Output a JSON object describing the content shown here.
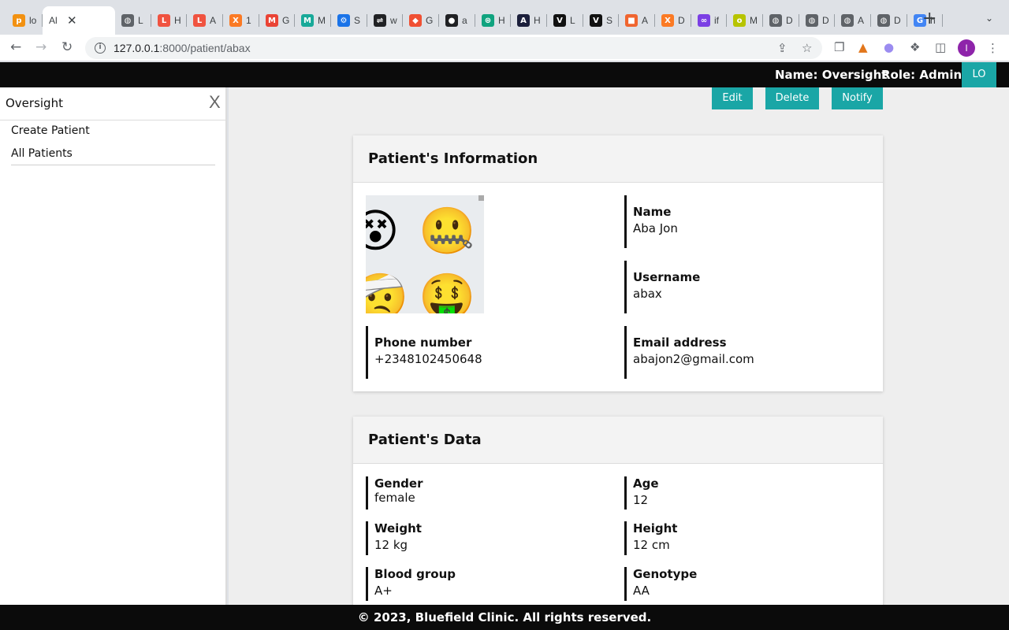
{
  "browser": {
    "tabs": [
      {
        "label": "lo",
        "icon": "pma",
        "color": "#f29111"
      },
      {
        "label": "Al",
        "icon": "",
        "color": "#ffffff",
        "active": true
      },
      {
        "label": "L",
        "icon": "globe",
        "color": "#5f6368"
      },
      {
        "label": "H",
        "icon": "laravel",
        "color": "#f05340"
      },
      {
        "label": "A",
        "icon": "laravel",
        "color": "#f05340"
      },
      {
        "label": "1",
        "icon": "xampp",
        "color": "#fb7a24"
      },
      {
        "label": "G",
        "icon": "gmail",
        "color": "#ea4335"
      },
      {
        "label": "M",
        "icon": "m",
        "color": "#18a999"
      },
      {
        "label": "S",
        "icon": "gear",
        "color": "#1a73e8"
      },
      {
        "label": "w",
        "icon": "net",
        "color": "#202124"
      },
      {
        "label": "G",
        "icon": "git",
        "color": "#f05033"
      },
      {
        "label": "a",
        "icon": "github",
        "color": "#202124"
      },
      {
        "label": "H",
        "icon": "gpt",
        "color": "#10a37f"
      },
      {
        "label": "H",
        "icon": "a",
        "color": "#1b1f3b"
      },
      {
        "label": "L",
        "icon": "v",
        "color": "#111111"
      },
      {
        "label": "S",
        "icon": "v",
        "color": "#111111"
      },
      {
        "label": "A",
        "icon": "box",
        "color": "#f0652f"
      },
      {
        "label": "D",
        "icon": "xampp",
        "color": "#fb7a24"
      },
      {
        "label": "if",
        "icon": "inf",
        "color": "#7b3fe4"
      },
      {
        "label": "M",
        "icon": "o",
        "color": "#b7c400"
      },
      {
        "label": "D",
        "icon": "globe",
        "color": "#5f6368"
      },
      {
        "label": "D",
        "icon": "globe",
        "color": "#5f6368"
      },
      {
        "label": "A",
        "icon": "globe",
        "color": "#5f6368"
      },
      {
        "label": "D",
        "icon": "globe",
        "color": "#5f6368"
      },
      {
        "label": "h",
        "icon": "google",
        "color": "#4285f4"
      }
    ],
    "url_host": "127.0.0.1",
    "url_path": ":8000/patient/abax",
    "profile_initial": "I"
  },
  "header": {
    "user_name": "Name: Oversight",
    "user_role": "Role: Admin",
    "logout_label": "LO"
  },
  "sidebar": {
    "brand": "Oversight",
    "close_label": "X",
    "items": [
      {
        "label": "Create Patient"
      },
      {
        "label": "All Patients"
      }
    ]
  },
  "actions": {
    "edit": "Edit",
    "delete": "Delete",
    "notify": "Notify"
  },
  "info_card": {
    "title": "Patient's Information",
    "avatar_emojis": [
      "😵",
      "🤐",
      "🤕",
      "🤑"
    ],
    "name_label": "Name",
    "name_value": "Aba Jon",
    "username_label": "Username",
    "username_value": "abax",
    "phone_label": "Phone number",
    "phone_value": "+2348102450648",
    "email_label": "Email address",
    "email_value": "abajon2@gmail.com"
  },
  "data_card": {
    "title": "Patient's Data",
    "gender_label": "Gender",
    "gender_value": "female",
    "age_label": "Age",
    "age_value": "12",
    "weight_label": "Weight",
    "weight_value": "12 kg",
    "height_label": "Height",
    "height_value": "12 cm",
    "blood_label": "Blood group",
    "blood_value": "A+",
    "genotype_label": "Genotype",
    "genotype_value": "AA"
  },
  "footer": {
    "text": "© 2023, Bluefield Clinic. All rights reserved."
  },
  "colors": {
    "accent": "#1aa6a6",
    "header_bg": "#0b0b0b",
    "main_bg": "#eeeeee"
  }
}
